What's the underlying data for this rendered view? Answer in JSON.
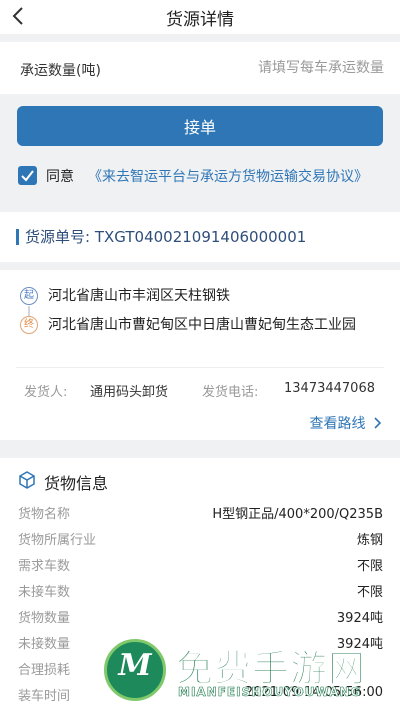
{
  "header": {
    "title": "货源详情"
  },
  "quantity": {
    "label": "承运数量(吨)",
    "placeholder": "请填写每车承运数量"
  },
  "accept_button": "接单",
  "agreement": {
    "prefix": "同意",
    "link": "《来去智运平台与承运方货物运输交易协议》",
    "checked": true
  },
  "order": {
    "label": "货源单号:",
    "number": "TXGT040021091406000001"
  },
  "route": {
    "start_badge": "起",
    "end_badge": "终",
    "start_address": "河北省唐山市丰润区天柱钢铁",
    "end_address": "河北省唐山市曹妃甸区中日唐山曹妃甸生态工业园",
    "shipper_label": "发货人:",
    "shipper_value": "通用码头卸货",
    "phone_label": "发货电话:",
    "phone_value": "13473447068",
    "view_route": "查看路线"
  },
  "goods": {
    "title": "货物信息",
    "rows": [
      {
        "label": "货物名称",
        "value": "H型钢正品/400*200/Q235B"
      },
      {
        "label": "货物所属行业",
        "value": "炼钢"
      },
      {
        "label": "需求车数",
        "value": "不限"
      },
      {
        "label": "未接车数",
        "value": "不限"
      },
      {
        "label": "货物数量",
        "value": "3924吨"
      },
      {
        "label": "未接数量",
        "value": "3924吨"
      },
      {
        "label": "合理损耗",
        "value": ""
      },
      {
        "label": "装车时间",
        "value": "2021-09-14 05:56:00"
      }
    ]
  },
  "watermark": {
    "logo_letter": "M",
    "text_cn": "免费手游网",
    "text_en": "MIANFEISHOUYOUWANG"
  },
  "colors": {
    "accent": "#2f76b6",
    "background": "#f0f1f3",
    "watermark_green": "#1f7a4e"
  }
}
